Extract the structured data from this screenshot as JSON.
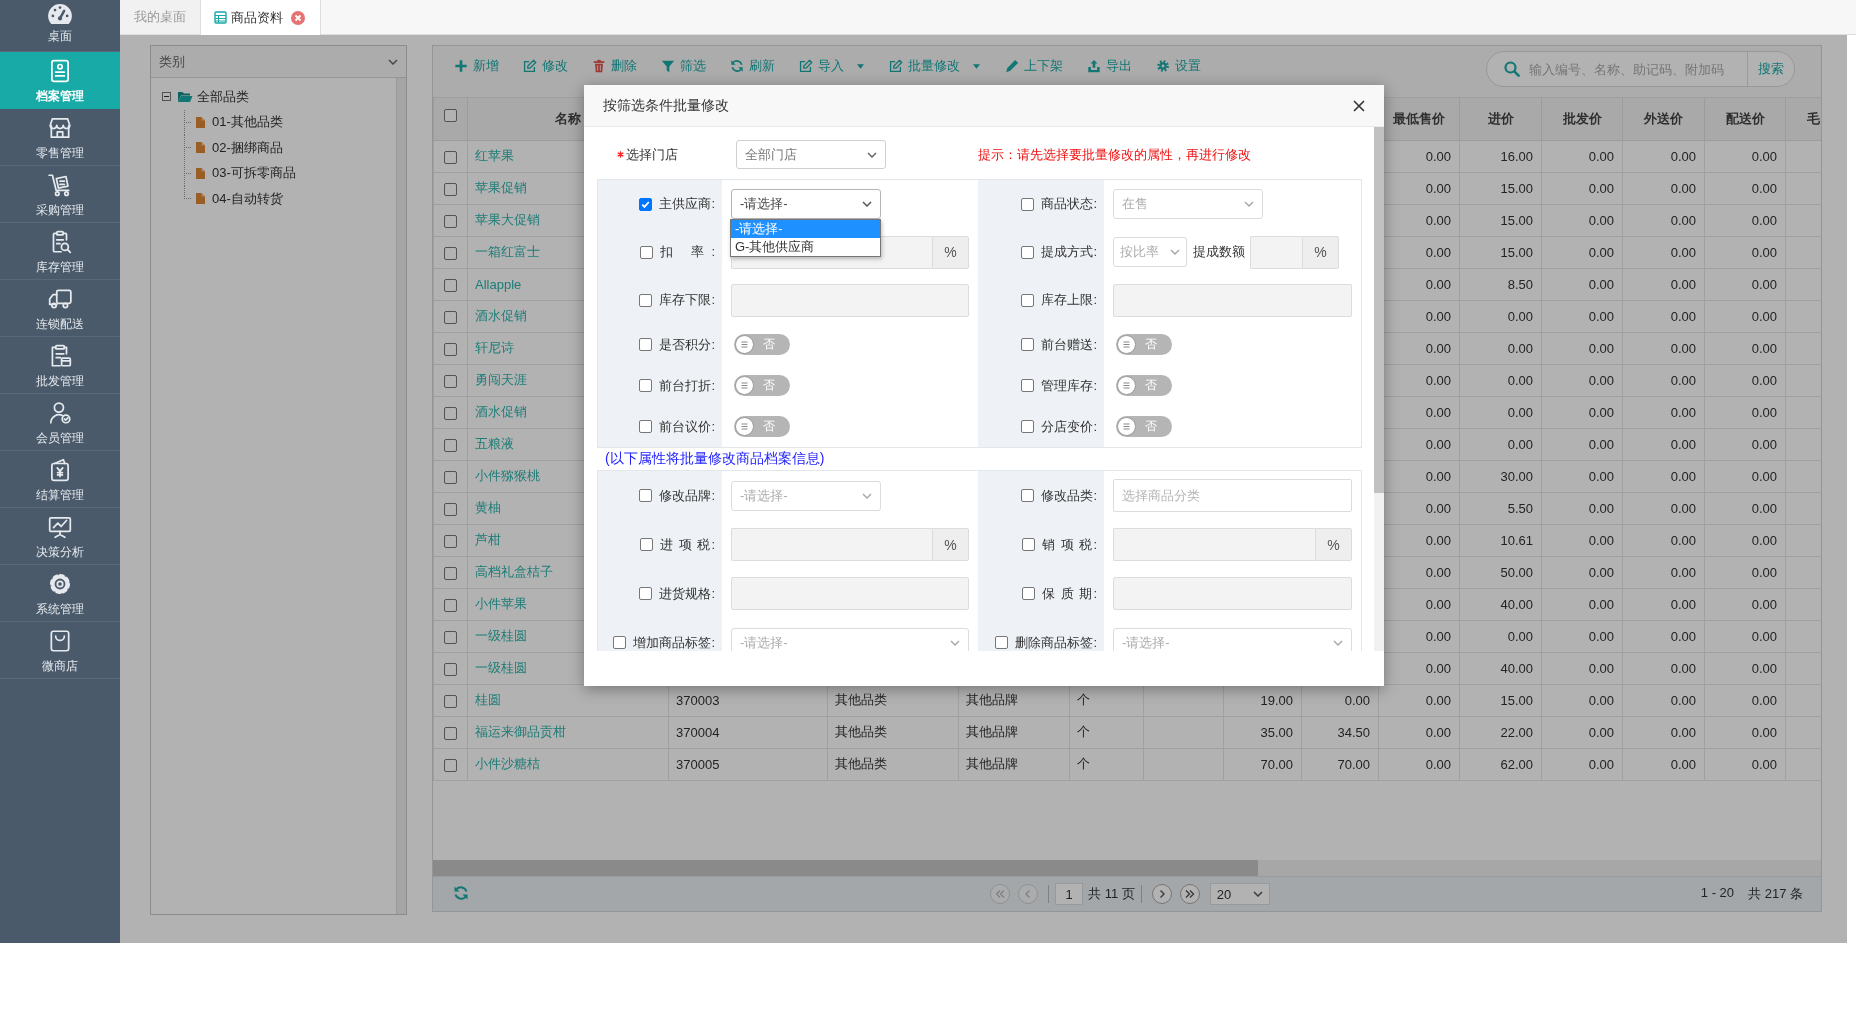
{
  "sidebar": {
    "items": [
      {
        "label": "桌面",
        "selected": false
      },
      {
        "label": "档案管理",
        "selected": true
      },
      {
        "label": "零售管理",
        "selected": false
      },
      {
        "label": "采购管理",
        "selected": false
      },
      {
        "label": "库存管理",
        "selected": false
      },
      {
        "label": "连锁配送",
        "selected": false
      },
      {
        "label": "批发管理",
        "selected": false
      },
      {
        "label": "会员管理",
        "selected": false
      },
      {
        "label": "结算管理",
        "selected": false
      },
      {
        "label": "决策分析",
        "selected": false
      },
      {
        "label": "系统管理",
        "selected": false
      },
      {
        "label": "微商店",
        "selected": false
      }
    ]
  },
  "tabs": [
    {
      "label": "我的桌面",
      "selected": false,
      "closable": false
    },
    {
      "label": "商品资料",
      "selected": true,
      "closable": true
    }
  ],
  "category_panel": {
    "title": "类别",
    "tree": [
      {
        "label": "全部品类",
        "expanded": true,
        "children": [
          {
            "label": "01-其他品类"
          },
          {
            "label": "02-捆绑商品"
          },
          {
            "label": "03-可拆零商品"
          },
          {
            "label": "04-自动转货"
          }
        ]
      }
    ]
  },
  "toolbar": {
    "buttons": [
      {
        "label": "新增",
        "dropdown": false
      },
      {
        "label": "修改",
        "dropdown": false
      },
      {
        "label": "删除",
        "dropdown": false
      },
      {
        "label": "筛选",
        "dropdown": false
      },
      {
        "label": "刷新",
        "dropdown": false
      },
      {
        "label": "导入",
        "dropdown": true
      },
      {
        "label": "批量修改",
        "dropdown": true
      },
      {
        "label": "上下架",
        "dropdown": false
      },
      {
        "label": "导出",
        "dropdown": false
      },
      {
        "label": "设置",
        "dropdown": false
      }
    ],
    "search": {
      "placeholder": "输入编号、名称、助记码、附加码",
      "button": "搜索"
    }
  },
  "table": {
    "select_all": false,
    "columns": [
      "名称",
      null,
      null,
      null,
      null,
      null,
      null,
      null,
      "最低售价",
      "进价",
      "批发价",
      "外送价",
      "配送价",
      "毛"
    ],
    "rows": [
      {
        "checked": false,
        "cells": [
          "红苹果",
          null,
          null,
          null,
          null,
          null,
          null,
          null,
          "0.00",
          "16.00",
          "0.00",
          "0.00",
          "0.00"
        ]
      },
      {
        "checked": false,
        "cells": [
          "苹果促销",
          null,
          null,
          null,
          null,
          null,
          null,
          null,
          "0.00",
          "15.00",
          "0.00",
          "0.00",
          "0.00"
        ]
      },
      {
        "checked": false,
        "cells": [
          "苹果大促销",
          null,
          null,
          null,
          null,
          null,
          null,
          null,
          "0.00",
          "15.00",
          "0.00",
          "0.00",
          "0.00"
        ]
      },
      {
        "checked": false,
        "cells": [
          "一箱红富士",
          null,
          null,
          null,
          null,
          null,
          null,
          null,
          "0.00",
          "15.00",
          "0.00",
          "0.00",
          "0.00"
        ]
      },
      {
        "checked": false,
        "cells": [
          "Allapple",
          null,
          null,
          null,
          null,
          null,
          null,
          null,
          "0.00",
          "8.50",
          "0.00",
          "0.00",
          "0.00"
        ]
      },
      {
        "checked": false,
        "cells": [
          "酒水促销",
          null,
          null,
          null,
          null,
          null,
          null,
          null,
          "0.00",
          "0.00",
          "0.00",
          "0.00",
          "0.00"
        ]
      },
      {
        "checked": false,
        "cells": [
          "轩尼诗",
          null,
          null,
          null,
          null,
          null,
          null,
          null,
          "0.00",
          "0.00",
          "0.00",
          "0.00",
          "0.00"
        ]
      },
      {
        "checked": false,
        "cells": [
          "勇闯天涯",
          null,
          null,
          null,
          null,
          null,
          null,
          null,
          "0.00",
          "0.00",
          "0.00",
          "0.00",
          "0.00"
        ]
      },
      {
        "checked": false,
        "cells": [
          "酒水促销",
          null,
          null,
          null,
          null,
          null,
          null,
          null,
          "0.00",
          "0.00",
          "0.00",
          "0.00",
          "0.00"
        ]
      },
      {
        "checked": false,
        "cells": [
          "五粮液",
          null,
          null,
          null,
          null,
          null,
          null,
          null,
          "0.00",
          "0.00",
          "0.00",
          "0.00",
          "0.00"
        ]
      },
      {
        "checked": false,
        "cells": [
          "小件猕猴桃",
          null,
          null,
          null,
          null,
          null,
          null,
          null,
          "0.00",
          "30.00",
          "0.00",
          "0.00",
          "0.00"
        ]
      },
      {
        "checked": false,
        "cells": [
          "黄柚",
          null,
          null,
          null,
          null,
          null,
          null,
          null,
          "0.00",
          "5.50",
          "0.00",
          "0.00",
          "0.00"
        ]
      },
      {
        "checked": false,
        "cells": [
          "芦柑",
          null,
          null,
          null,
          null,
          null,
          null,
          null,
          "0.00",
          "10.61",
          "0.00",
          "0.00",
          "0.00"
        ]
      },
      {
        "checked": false,
        "cells": [
          "高档礼盒桔子",
          null,
          null,
          null,
          null,
          null,
          null,
          null,
          "0.00",
          "50.00",
          "0.00",
          "0.00",
          "0.00"
        ]
      },
      {
        "checked": false,
        "cells": [
          "小件苹果",
          null,
          null,
          null,
          null,
          null,
          null,
          null,
          "0.00",
          "40.00",
          "0.00",
          "0.00",
          "0.00"
        ]
      },
      {
        "checked": false,
        "cells": [
          "一级桂圆",
          null,
          null,
          null,
          null,
          null,
          null,
          null,
          "0.00",
          "0.00",
          "0.00",
          "0.00",
          "0.00"
        ]
      },
      {
        "checked": false,
        "cells": [
          "一级桂圆",
          null,
          null,
          null,
          null,
          null,
          null,
          null,
          "0.00",
          "40.00",
          "0.00",
          "0.00",
          "0.00"
        ]
      },
      {
        "checked": false,
        "cells": [
          "桂圆",
          "370003",
          "其他品类",
          "其他品牌",
          "个",
          null,
          "19.00",
          "0.00",
          "0.00",
          "15.00",
          "0.00",
          "0.00",
          "0.00"
        ]
      },
      {
        "checked": false,
        "cells": [
          "福运来御品贡柑",
          "370004",
          "其他品类",
          "其他品牌",
          "个",
          null,
          "35.00",
          "34.50",
          "0.00",
          "22.00",
          "0.00",
          "0.00",
          "0.00"
        ]
      },
      {
        "checked": false,
        "cells": [
          "小件沙糖桔",
          "370005",
          "其他品类",
          "其他品牌",
          "个",
          null,
          "70.00",
          "70.00",
          "0.00",
          "62.00",
          "0.00",
          "0.00",
          "0.00"
        ]
      }
    ]
  },
  "pager": {
    "buttons": [
      {
        "kind": "first",
        "disabled": true
      },
      {
        "kind": "prev",
        "disabled": true
      },
      {
        "kind": "next",
        "disabled": false
      },
      {
        "kind": "last",
        "disabled": false
      }
    ],
    "page": "1",
    "pages": "共 11 页",
    "page_size": "20",
    "range": "1 - 20",
    "total": "共 217 条"
  },
  "modal": {
    "title": "按筛选条件批量修改",
    "store": {
      "label": "选择门店",
      "required": true,
      "value": "全部门店"
    },
    "hint": "提示：请先选择要批量修改的属性，再进行修改",
    "sections": [
      {
        "rows": [
          [
            {
              "kind": "select",
              "label": "主供应商:",
              "checked": true,
              "disabled": false,
              "value": "-请选择-",
              "open": true,
              "options": [
                {
                  "label": "-请选择-",
                  "selected": true
                },
                {
                  "label": "G-其他供应商",
                  "selected": false
                }
              ]
            },
            {
              "kind": "select",
              "label": "商品状态:",
              "checked": false,
              "disabled": true,
              "value": "在售"
            }
          ],
          [
            {
              "kind": "input",
              "label": "扣 率:",
              "checked": false,
              "disabled": true,
              "addon": "%"
            },
            {
              "kind": "select_input",
              "label": "提成方式:",
              "checked": false,
              "disabled": true,
              "value": "按比率",
              "sublabel": "提成数额",
              "addon": "%"
            }
          ],
          [
            {
              "kind": "input",
              "label": "库存下限:",
              "checked": false,
              "disabled": true
            },
            {
              "kind": "input",
              "label": "库存上限:",
              "checked": false,
              "disabled": true
            }
          ],
          [
            {
              "kind": "toggle",
              "label": "是否积分:",
              "checked": false,
              "on": false,
              "text": "否"
            },
            {
              "kind": "toggle",
              "label": "前台赠送:",
              "checked": false,
              "on": false,
              "text": "否"
            }
          ],
          [
            {
              "kind": "toggle",
              "label": "前台打折:",
              "checked": false,
              "on": false,
              "text": "否"
            },
            {
              "kind": "toggle",
              "label": "管理库存:",
              "checked": false,
              "on": false,
              "text": "否"
            }
          ],
          [
            {
              "kind": "toggle",
              "label": "前台议价:",
              "checked": false,
              "on": false,
              "text": "否"
            },
            {
              "kind": "toggle",
              "label": "分店变价:",
              "checked": false,
              "on": false,
              "text": "否"
            }
          ]
        ]
      },
      {
        "note": "(以下属性将批量修改商品档案信息)",
        "rows": [
          [
            {
              "kind": "select",
              "label": "修改品牌:",
              "checked": false,
              "disabled": true,
              "value": "-请选择-"
            },
            {
              "kind": "input",
              "label": "修改品类:",
              "checked": false,
              "disabled": false,
              "placeholder": "选择商品分类"
            }
          ],
          [
            {
              "kind": "input",
              "label": "进 项 税:",
              "checked": false,
              "disabled": true,
              "addon": "%"
            },
            {
              "kind": "input",
              "label": "销 项 税:",
              "checked": false,
              "disabled": true,
              "addon": "%"
            }
          ],
          [
            {
              "kind": "input",
              "label": "进货规格:",
              "checked": false,
              "disabled": true
            },
            {
              "kind": "input",
              "label": "保 质 期:",
              "checked": false,
              "disabled": true
            }
          ],
          [
            {
              "kind": "tags",
              "label": "增加商品标签:",
              "checked": false,
              "disabled": true,
              "value": "-请选择-"
            },
            {
              "kind": "tags",
              "label": "删除商品标签:",
              "checked": false,
              "disabled": true,
              "value": "-请选择-"
            }
          ]
        ]
      }
    ]
  }
}
